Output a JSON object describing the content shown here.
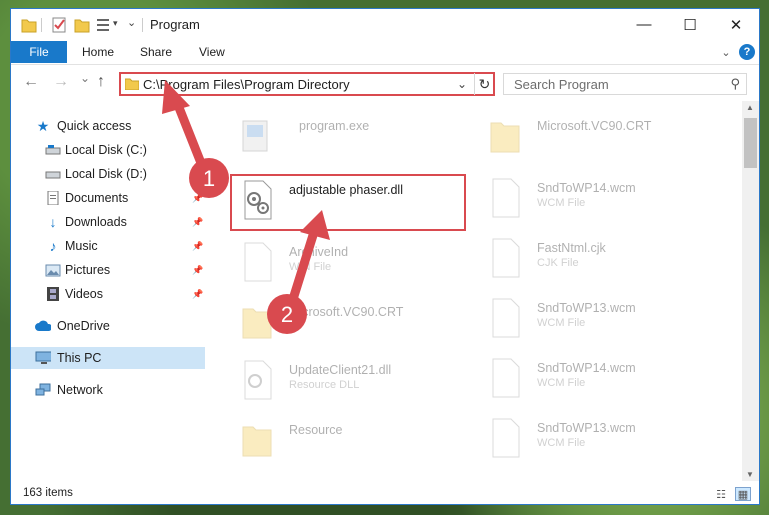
{
  "window": {
    "title": "Program",
    "minimize_glyph": "—",
    "maximize_glyph": "☐",
    "close_glyph": "✕"
  },
  "ribbon": {
    "file_label": "File",
    "home_label": "Home",
    "share_label": "Share",
    "view_label": "View"
  },
  "nav": {
    "back_glyph": "←",
    "forward_glyph": "→",
    "dropdown_glyph": "⌄",
    "up_glyph": "↑",
    "address": "C:\\Program Files\\Program Directory",
    "refresh_glyph": "↻",
    "search_placeholder": "Search Program"
  },
  "sidebar": {
    "items": [
      {
        "label": "Quick access",
        "icon": "star-icon"
      },
      {
        "label": "Local Disk (C:)",
        "icon": "drive-icon"
      },
      {
        "label": "Local Disk (D:)",
        "icon": "drive-icon"
      },
      {
        "label": "Documents",
        "icon": "documents-icon"
      },
      {
        "label": "Downloads",
        "icon": "download-arrow-icon"
      },
      {
        "label": "Music",
        "icon": "music-note-icon"
      },
      {
        "label": "Pictures",
        "icon": "pictures-icon"
      },
      {
        "label": "Videos",
        "icon": "film-icon"
      },
      {
        "label": "OneDrive",
        "icon": "cloud-icon"
      },
      {
        "label": "This PC",
        "icon": "computer-icon"
      },
      {
        "label": "Network",
        "icon": "network-icon"
      }
    ]
  },
  "files": {
    "left": [
      {
        "name": "program.exe",
        "type": ""
      },
      {
        "name": "adjustable phaser.dll",
        "type": ""
      },
      {
        "name": "ArchiveInd",
        "type": "WIN File"
      },
      {
        "name": "Microsoft.VC90.CRT",
        "type": ""
      },
      {
        "name": "UpdateClient21.dll",
        "type": "Resource DLL"
      },
      {
        "name": "Resource",
        "type": ""
      }
    ],
    "right": [
      {
        "name": "Microsoft.VC90.CRT",
        "type": ""
      },
      {
        "name": "SndToWP14.wcm",
        "type": "WCM File"
      },
      {
        "name": "FastNtml.cjk",
        "type": "CJK File"
      },
      {
        "name": "SndToWP13.wcm",
        "type": "WCM File"
      },
      {
        "name": "SndToWP14.wcm",
        "type": "WCM File"
      },
      {
        "name": "SndToWP13.wcm",
        "type": "WCM File"
      }
    ]
  },
  "status": {
    "item_count": "163 items"
  },
  "annotations": {
    "badge1": "1",
    "badge2": "2",
    "color": "#d94a4f"
  },
  "colors": {
    "accent": "#1979ca",
    "highlight_red": "#d94a4f",
    "selected_bg": "#cce4f7"
  }
}
